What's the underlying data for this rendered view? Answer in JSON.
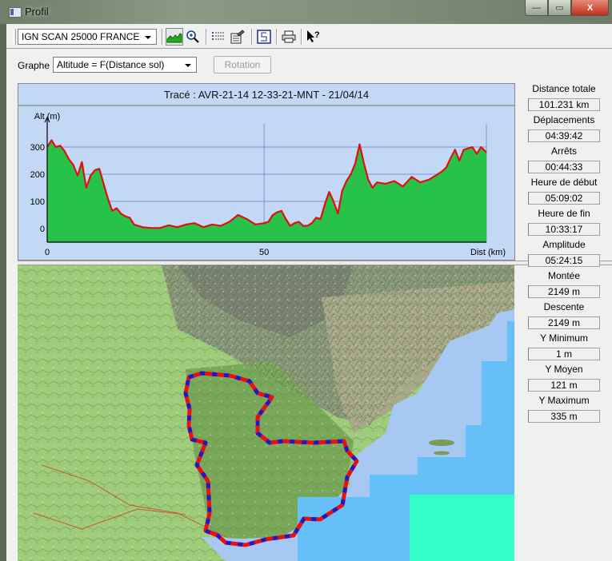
{
  "window": {
    "title": "Profil",
    "controls": {
      "minimize": "—",
      "maximize": "▭",
      "close": "X"
    }
  },
  "toolbar": {
    "map_source": "IGN SCAN 25000 FRANCE",
    "buttons": [
      {
        "name": "profile-graph",
        "icon": "profile-chart-icon",
        "pressed": true
      },
      {
        "name": "zoom",
        "icon": "zoom-icon"
      },
      {
        "name": "list",
        "icon": "list-icon"
      },
      {
        "name": "properties",
        "icon": "properties-icon"
      },
      {
        "name": "curve",
        "icon": "curve-icon"
      },
      {
        "name": "print",
        "icon": "printer-icon"
      },
      {
        "name": "help",
        "icon": "help-pointer-icon"
      }
    ]
  },
  "graph_controls": {
    "label": "Graphe",
    "selected": "Altitude = F(Distance sol)",
    "rotation_button": "Rotation"
  },
  "profile": {
    "title": "Tracé : AVR-21-14 12-33-21-MNT - 21/04/14",
    "colors": {
      "background": "#c3d8f4",
      "fill": "#27c24a",
      "line": "#e01010",
      "grid": "#7d95d8"
    }
  },
  "chart_data": {
    "type": "area",
    "title": "Tracé : AVR-21-14 12-33-21-MNT - 21/04/14",
    "xlabel": "Dist (km)",
    "ylabel": "Alt (m)",
    "xlim": [
      0,
      101.231
    ],
    "ylim": [
      -50,
      380
    ],
    "x_ticks": [
      0,
      50
    ],
    "x_tick_labels": [
      "0",
      "50",
      "Dist (km)"
    ],
    "y_ticks": [
      0,
      100,
      200,
      300
    ],
    "y_tick_labels": [
      "0",
      "100",
      "200",
      "300"
    ],
    "grid": true,
    "x": [
      0,
      1,
      2,
      3,
      4,
      5,
      6,
      7,
      8,
      9,
      10,
      11,
      12,
      13,
      14,
      15,
      16,
      17,
      18,
      19,
      20,
      22,
      24,
      26,
      28,
      30,
      32,
      34,
      36,
      38,
      40,
      42,
      44,
      46,
      48,
      50,
      51,
      52,
      53,
      54,
      55,
      56,
      57,
      58,
      59,
      60,
      61,
      62,
      63,
      64,
      65,
      66,
      67,
      68,
      69,
      70,
      71,
      72,
      73,
      74,
      75,
      76,
      78,
      80,
      82,
      84,
      86,
      88,
      90,
      91,
      92,
      93,
      94,
      95,
      96,
      97,
      98,
      99,
      100,
      101.231
    ],
    "values": [
      300,
      325,
      300,
      305,
      285,
      255,
      235,
      195,
      245,
      150,
      195,
      215,
      220,
      165,
      110,
      65,
      75,
      55,
      45,
      40,
      15,
      5,
      2,
      2,
      12,
      5,
      15,
      20,
      5,
      15,
      10,
      25,
      50,
      35,
      15,
      20,
      25,
      50,
      60,
      65,
      35,
      10,
      20,
      25,
      10,
      10,
      20,
      40,
      35,
      90,
      135,
      100,
      55,
      140,
      175,
      200,
      240,
      310,
      240,
      180,
      150,
      170,
      165,
      175,
      155,
      190,
      170,
      180,
      200,
      210,
      225,
      260,
      290,
      250,
      290,
      295,
      300,
      275,
      300,
      280
    ]
  },
  "map": {
    "route_name": "AVR-21-14 12-33-21-MNT",
    "route_colors": [
      "#e81010",
      "#1a1acc"
    ]
  },
  "stats": [
    {
      "label": "Distance totale",
      "value": "101.231 km"
    },
    {
      "label": "Déplacements",
      "value": "04:39:42"
    },
    {
      "label": "Arrêts",
      "value": "00:44:33"
    },
    {
      "label": "Heure de début",
      "value": "05:09:02"
    },
    {
      "label": "Heure de fin",
      "value": "10:33:17"
    },
    {
      "label": "Amplitude",
      "value": "05:24:15"
    },
    {
      "label": "Montée",
      "value": "2149 m"
    },
    {
      "label": "Descente",
      "value": "2149 m"
    },
    {
      "label": "Y Minimum",
      "value": "1 m"
    },
    {
      "label": "Y Moyen",
      "value": "121 m"
    },
    {
      "label": "Y Maximum",
      "value": "335 m"
    }
  ]
}
